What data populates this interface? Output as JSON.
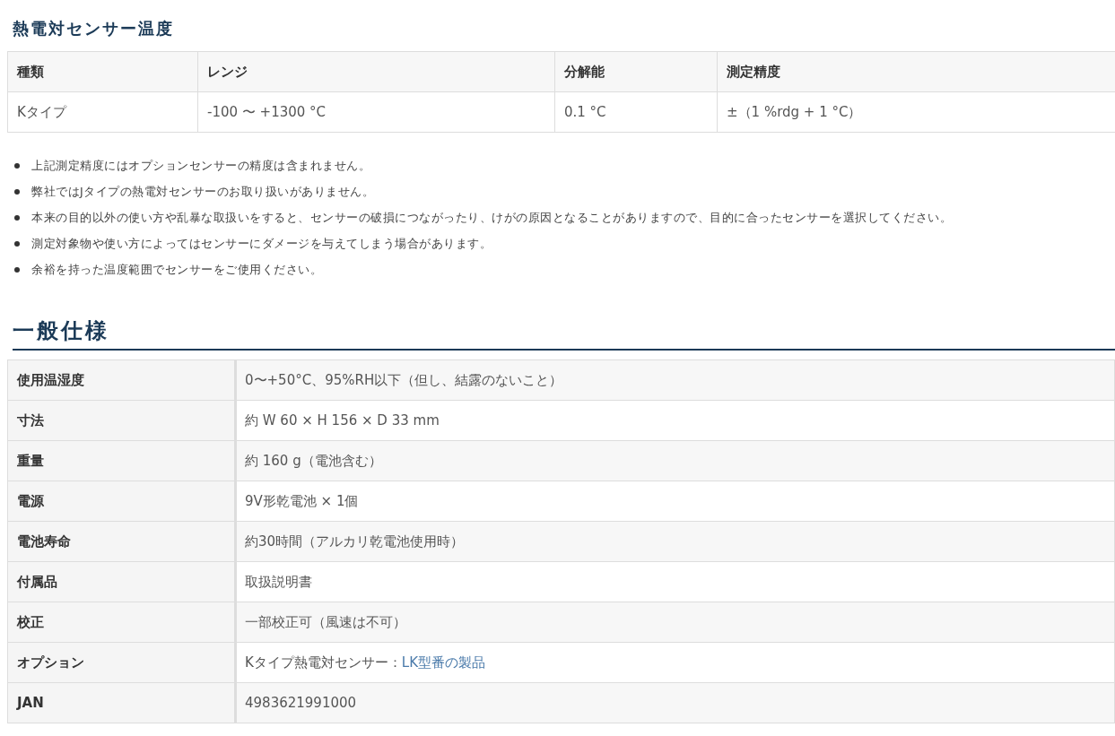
{
  "sensor_section": {
    "title": "熱電対センサー温度",
    "table": {
      "columns": [
        "種類",
        "レンジ",
        "分解能",
        "測定精度"
      ],
      "rows": [
        [
          "Kタイプ",
          "-100 〜 +1300 °C",
          "0.1 °C",
          "±（1 %rdg + 1 °C）"
        ]
      ]
    },
    "notes": [
      "上記測定精度にはオプションセンサーの精度は含まれません。",
      "弊社ではJタイプの熱電対センサーのお取り扱いがありません。",
      "本来の目的以外の使い方や乱暴な取扱いをすると、センサーの破損につながったり、けがの原因となることがありますので、目的に合ったセンサーを選択してください。",
      "測定対象物や使い方によってはセンサーにダメージを与えてしまう場合があります。",
      "余裕を持った温度範囲でセンサーをご使用ください。"
    ]
  },
  "general_section": {
    "title": "一般仕様",
    "rows": [
      {
        "label": "使用温湿度",
        "value": "0〜+50°C、95%RH以下（但し、結露のないこと）"
      },
      {
        "label": "寸法",
        "value": "約 W 60 × H 156 × D 33 mm"
      },
      {
        "label": "重量",
        "value": "約 160 g（電池含む）"
      },
      {
        "label": "電源",
        "value": "9V形乾電池 × 1個"
      },
      {
        "label": "電池寿命",
        "value": "約30時間（アルカリ乾電池使用時）"
      },
      {
        "label": "付属品",
        "value": "取扱説明書"
      },
      {
        "label": "校正",
        "value": "一部校正可（風速は不可）"
      },
      {
        "label": "オプション",
        "value": "Kタイプ熱電対センサー：",
        "link": "LK型番の製品"
      },
      {
        "label": "JAN",
        "value": "4983621991000"
      }
    ]
  }
}
